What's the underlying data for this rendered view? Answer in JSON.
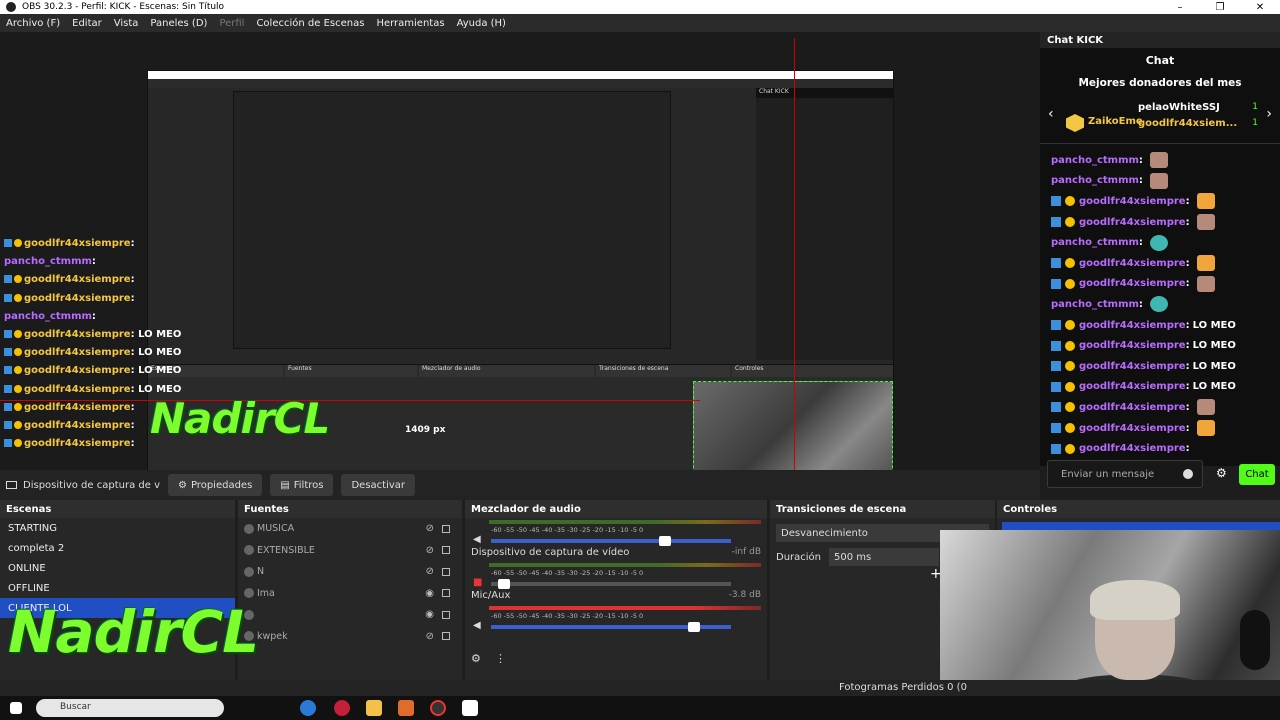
{
  "window": {
    "title": "OBS 30.2.3 - Perfil: KICK - Escenas: Sin Título",
    "minimize": "–",
    "maximize": "❐",
    "close": "✕"
  },
  "menu": [
    {
      "label": "Archivo (F)",
      "enabled": true
    },
    {
      "label": "Editar",
      "enabled": true
    },
    {
      "label": "Vista",
      "enabled": true
    },
    {
      "label": "Paneles (D)",
      "enabled": true
    },
    {
      "label": "Perfil",
      "enabled": false
    },
    {
      "label": "Colección de Escenas",
      "enabled": true
    },
    {
      "label": "Herramientas",
      "enabled": true
    },
    {
      "label": "Ayuda (H)",
      "enabled": true
    }
  ],
  "preview": {
    "nested_size_label": "1409 px",
    "overlay_chat": [
      {
        "user": "goodlfr44xsiempre",
        "msg": "",
        "color": "gold",
        "badges": true
      },
      {
        "user": "pancho_ctmmm",
        "msg": "",
        "color": "purple",
        "badges": false
      },
      {
        "user": "goodlfr44xsiempre",
        "msg": "",
        "color": "gold",
        "badges": true
      },
      {
        "user": "goodlfr44xsiempre",
        "msg": "",
        "color": "gold",
        "badges": true
      },
      {
        "user": "pancho_ctmmm",
        "msg": "",
        "color": "purple",
        "badges": false
      },
      {
        "user": "goodlfr44xsiempre",
        "msg": "LO MEO",
        "color": "gold",
        "badges": true
      },
      {
        "user": "goodlfr44xsiempre",
        "msg": "LO MEO",
        "color": "gold",
        "badges": true
      },
      {
        "user": "goodlfr44xsiempre",
        "msg": "LO MEO",
        "color": "gold",
        "badges": true
      },
      {
        "user": "goodlfr44xsiempre",
        "msg": "LO MEO",
        "color": "gold",
        "badges": true
      },
      {
        "user": "goodlfr44xsiempre",
        "msg": "",
        "color": "gold",
        "badges": true
      },
      {
        "user": "goodlfr44xsiempre",
        "msg": "",
        "color": "gold",
        "badges": true
      },
      {
        "user": "goodlfr44xsiempre",
        "msg": "",
        "color": "gold",
        "badges": true
      }
    ],
    "logo": "NadirCL"
  },
  "chat_dock": {
    "title": "Chat KICK",
    "header": "Chat",
    "donors_title": "Mejores donadores del mes",
    "donors": [
      {
        "name": "ZaikoEme",
        "count": ""
      },
      {
        "name": "pelaoWhiteSSJ",
        "count": "1"
      },
      {
        "name": "goodlfr44xsiem...",
        "count": "1"
      }
    ],
    "messages": [
      {
        "user": "pancho_ctmmm",
        "text": "",
        "color": "purple",
        "badges": false,
        "emote": "face"
      },
      {
        "user": "pancho_ctmmm",
        "text": "",
        "color": "purple",
        "badges": false,
        "emote": "face"
      },
      {
        "user": "goodlfr44xsiempre",
        "text": "",
        "color": "purple",
        "badges": true,
        "emote": "fire"
      },
      {
        "user": "goodlfr44xsiempre",
        "text": "",
        "color": "purple",
        "badges": true,
        "emote": "face"
      },
      {
        "user": "pancho_ctmmm",
        "text": "",
        "color": "purple",
        "badges": false,
        "emote": "blue"
      },
      {
        "user": "goodlfr44xsiempre",
        "text": "",
        "color": "purple",
        "badges": true,
        "emote": "fire"
      },
      {
        "user": "goodlfr44xsiempre",
        "text": "",
        "color": "purple",
        "badges": true,
        "emote": "face"
      },
      {
        "user": "pancho_ctmmm",
        "text": "",
        "color": "purple",
        "badges": false,
        "emote": "blue"
      },
      {
        "user": "goodlfr44xsiempre",
        "text": "LO MEO",
        "color": "purple",
        "badges": true,
        "emote": ""
      },
      {
        "user": "goodlfr44xsiempre",
        "text": "LO MEO",
        "color": "purple",
        "badges": true,
        "emote": ""
      },
      {
        "user": "goodlfr44xsiempre",
        "text": "LO MEO",
        "color": "purple",
        "badges": true,
        "emote": ""
      },
      {
        "user": "goodlfr44xsiempre",
        "text": "LO MEO",
        "color": "purple",
        "badges": true,
        "emote": ""
      },
      {
        "user": "goodlfr44xsiempre",
        "text": "",
        "color": "purple",
        "badges": true,
        "emote": "face"
      },
      {
        "user": "goodlfr44xsiempre",
        "text": "",
        "color": "purple",
        "badges": true,
        "emote": "fire"
      },
      {
        "user": "goodlfr44xsiempre",
        "text": "",
        "color": "purple",
        "badges": true,
        "emote": ""
      }
    ],
    "input_placeholder": "Enviar un mensaje",
    "send_label": "Chat",
    "accent": "#53fc18"
  },
  "source_toolbar": {
    "source_name": "Dispositivo de captura de v",
    "properties": "Propiedades",
    "filters": "Filtros",
    "deactivate": "Desactivar"
  },
  "scenes": {
    "title": "Escenas",
    "items": [
      "STARTING",
      "completa 2",
      "ONLINE",
      "OFFLINE",
      "CLIENTE LOL"
    ],
    "active_index": 4
  },
  "sources": {
    "title": "Fuentes",
    "items": [
      {
        "name": "MUSICA",
        "visible": false
      },
      {
        "name": "EXTENSIBLE",
        "visible": false
      },
      {
        "name": "N",
        "visible": false
      },
      {
        "name": "Ima",
        "visible": true
      },
      {
        "name": "",
        "visible": true
      },
      {
        "name": "kwpek",
        "visible": false
      }
    ]
  },
  "mixer": {
    "title": "Mezclador de audio",
    "ticks": "-60  -55  -50  -45  -40  -35  -30  -25  -20  -15  -10   -5    0",
    "channels": [
      {
        "name": "",
        "db": "",
        "fader": 0.7,
        "muted": false
      },
      {
        "name": "Dispositivo de captura de vídeo",
        "db": "-inf dB",
        "fader": 0.03,
        "muted": true
      },
      {
        "name": "Mic/Aux",
        "db": "-3.8 dB",
        "fader": 0.82,
        "muted": false
      }
    ]
  },
  "transitions": {
    "title": "Transiciones de escena",
    "type": "Desvanecimiento",
    "duration_label": "Duración",
    "duration_value": "500 ms",
    "add": "+"
  },
  "controls": {
    "title": "Controles"
  },
  "status": {
    "dropped_frames": "Fotogramas Perdidos 0 (0"
  },
  "taskbar": {
    "search": "Buscar"
  },
  "colors": {
    "obs_bg": "#272727",
    "selected": "#1f4fc3",
    "kick_green": "#53fc18",
    "gold": "#f3c743",
    "purple": "#b86bff",
    "red_guide": "#d10000"
  }
}
